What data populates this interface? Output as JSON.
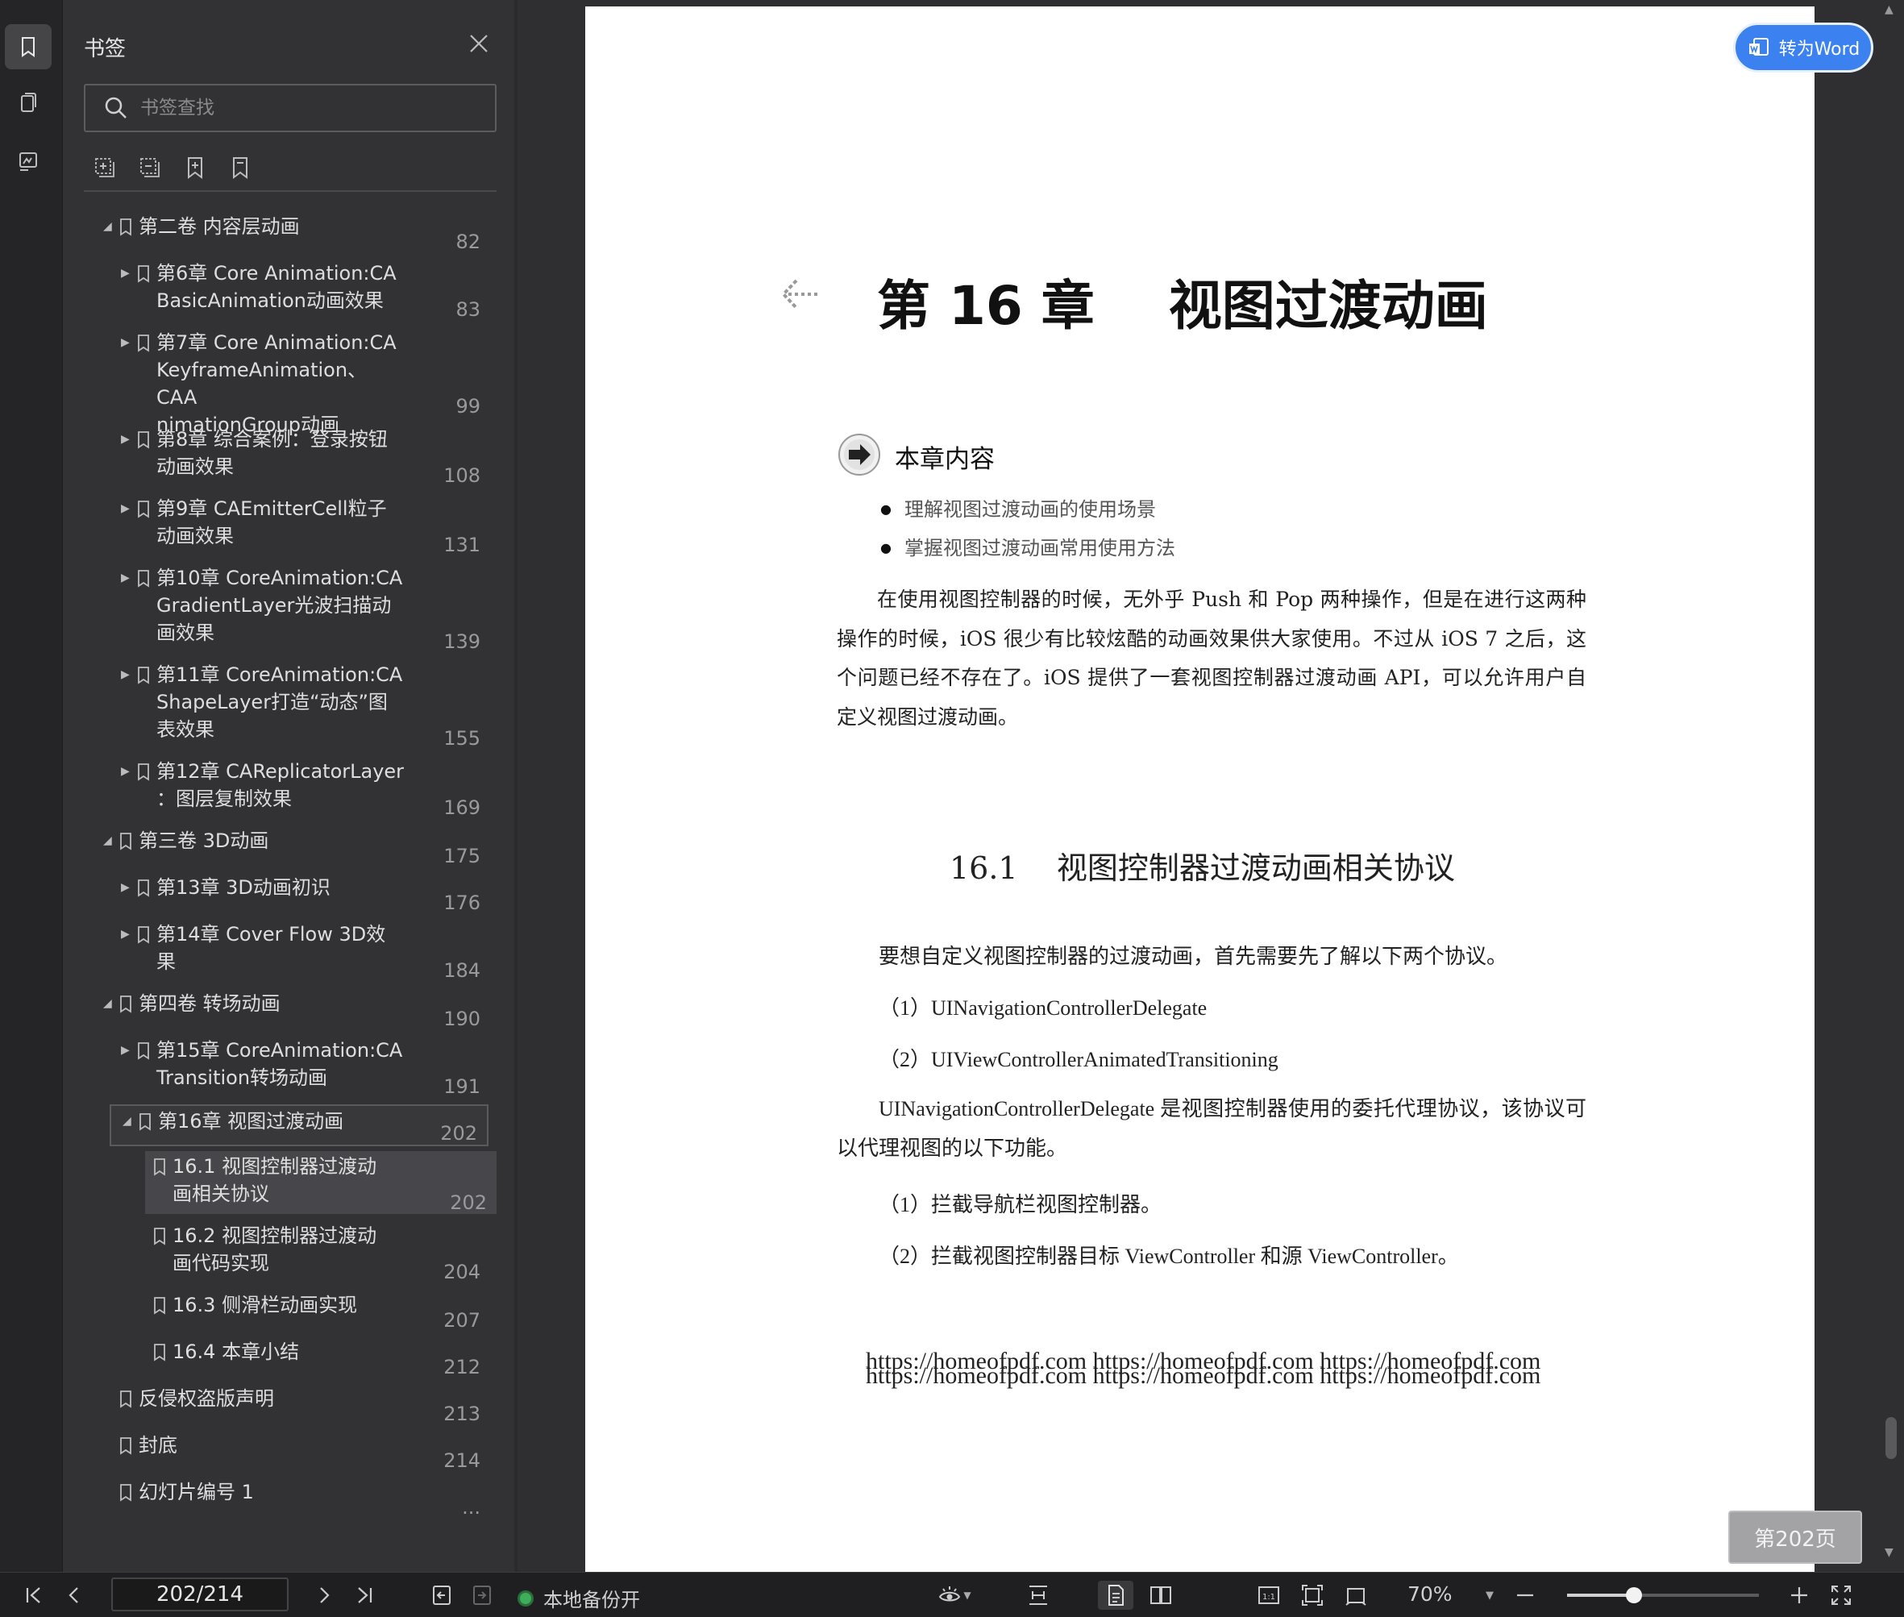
{
  "panel": {
    "title": "书签",
    "search_placeholder": "书签查找"
  },
  "tree": [
    {
      "level": 0,
      "arrow": "down",
      "label": "第二卷  内容层动画",
      "page": "82"
    },
    {
      "level": 1,
      "arrow": "right",
      "label": "第6章  Core Animation:CA\nBasicAnimation动画效果",
      "page": "83"
    },
    {
      "level": 1,
      "arrow": "right",
      "label": "第7章  Core Animation:CA\nKeyframeAnimation、CAA\nnimationGroup动画",
      "page": "99"
    },
    {
      "level": 1,
      "arrow": "right",
      "label": "第8章  综合案例：登录按钮\n动画效果",
      "page": "108"
    },
    {
      "level": 1,
      "arrow": "right",
      "label": "第9章  CAEmitterCell粒子\n动画效果",
      "page": "131"
    },
    {
      "level": 1,
      "arrow": "right",
      "label": "第10章  CoreAnimation:CA\nGradientLayer光波扫描动\n画效果",
      "page": "139"
    },
    {
      "level": 1,
      "arrow": "right",
      "label": "第11章  CoreAnimation:CA\nShapeLayer打造“动态”图\n表效果",
      "page": "155"
    },
    {
      "level": 1,
      "arrow": "right",
      "label": "第12章  CAReplicatorLayer\n：图层复制效果",
      "page": "169"
    },
    {
      "level": 0,
      "arrow": "down",
      "label": "第三卷  3D动画",
      "page": "175"
    },
    {
      "level": 1,
      "arrow": "right",
      "label": "第13章  3D动画初识",
      "page": "176"
    },
    {
      "level": 1,
      "arrow": "right",
      "label": "第14章  Cover Flow 3D效\n果",
      "page": "184"
    },
    {
      "level": 0,
      "arrow": "down",
      "label": "第四卷  转场动画",
      "page": "190"
    },
    {
      "level": 1,
      "arrow": "right",
      "label": "第15章  CoreAnimation:CA\nTransition转场动画",
      "page": "191"
    },
    {
      "level": 1,
      "arrow": "down",
      "label": "第16章  视图过渡动画",
      "page": "202",
      "state": "outline"
    },
    {
      "level": 2,
      "arrow": "",
      "label": "16.1  视图控制器过渡动\n画相关协议",
      "page": "202",
      "state": "fill"
    },
    {
      "level": 2,
      "arrow": "",
      "label": "16.2  视图控制器过渡动\n画代码实现",
      "page": "204"
    },
    {
      "level": 2,
      "arrow": "",
      "label": "16.3  侧滑栏动画实现",
      "page": "207"
    },
    {
      "level": 2,
      "arrow": "",
      "label": "16.4  本章小结",
      "page": "212"
    },
    {
      "level": 0,
      "arrow": "",
      "label": "反侵权盗版声明",
      "page": "213"
    },
    {
      "level": 0,
      "arrow": "",
      "label": "封底",
      "page": "214"
    },
    {
      "level": 0,
      "arrow": "",
      "label": "幻灯片编号 1",
      "page": "..."
    }
  ],
  "doc": {
    "word_button": "转为Word",
    "chapter_title": "第 16 章    视图过渡动画",
    "contents_heading": "本章内容",
    "bullets": [
      "理解视图过渡动画的使用场景",
      "掌握视图过渡动画常用使用方法"
    ],
    "intro_paragraph": "在使用视图控制器的时候，无外乎 Push 和 Pop 两种操作，但是在进行这两种操作的时候，iOS 很少有比较炫酷的动画效果供大家使用。不过从 iOS 7 之后，这个问题已经不存在了。iOS 提供了一套视图控制器过渡动画 API，可以允许用户自定义视图过渡动画。",
    "section_title": "16.1    视图控制器过渡动画相关协议",
    "lines": [
      "要想自定义视图控制器的过渡动画，首先需要先了解以下两个协议。",
      "（1）UINavigationControllerDelegate",
      "（2）UIViewControllerAnimatedTransitioning"
    ],
    "para2": "UINavigationControllerDelegate 是视图控制器使用的委托代理协议，该协议可以代理视图的以下功能。",
    "lines2": [
      "（1）拦截导航栏视图控制器。",
      "（2）拦截视图控制器目标 ViewController 和源 ViewController。"
    ],
    "watermark_1": "https://homeofpdf.com https://homeofpdf.com https://homeofpdf.com",
    "watermark_2": "https://homeofpdf.com https://homeofpdf.com https://homeofpdf.com",
    "page_indicator": "第202页"
  },
  "bottom": {
    "page_value": "202/214",
    "backup_status": "本地备份开",
    "zoom": "70%",
    "zoom_fraction": 0.35
  }
}
